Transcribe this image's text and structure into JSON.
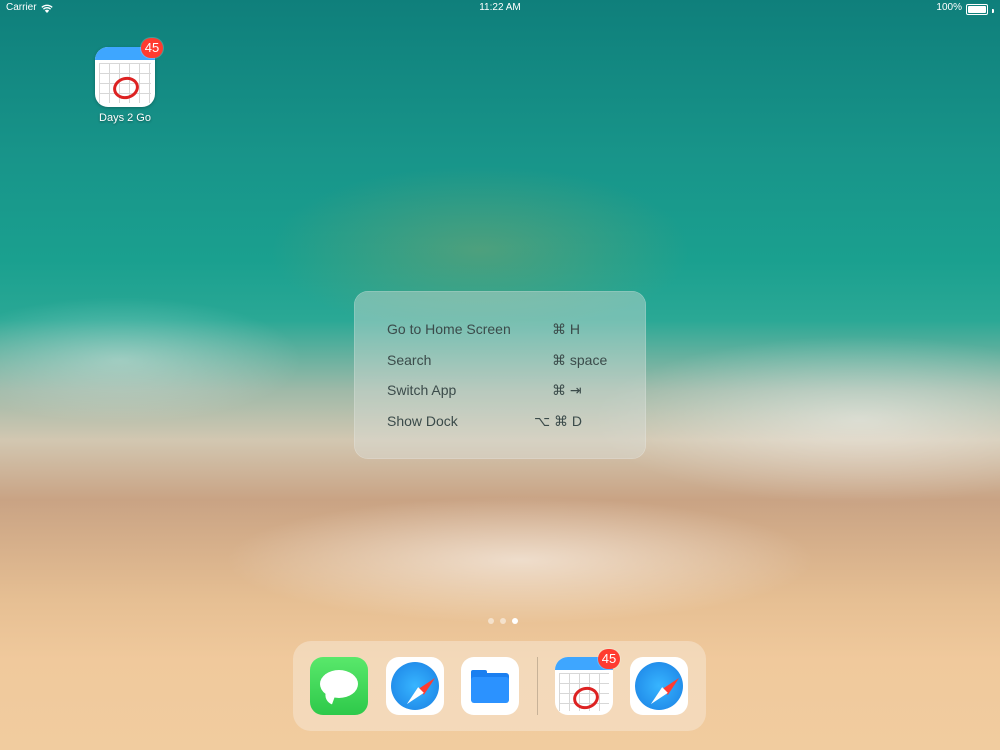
{
  "status_bar": {
    "carrier": "Carrier",
    "time": "11:22 AM",
    "battery": "100%"
  },
  "home_apps": [
    {
      "label": "Days 2 Go",
      "badge": "45"
    }
  ],
  "shortcuts": [
    {
      "action": "Go to Home Screen",
      "keys": "⌘ H"
    },
    {
      "action": "Search",
      "keys": "⌘ space"
    },
    {
      "action": "Switch App",
      "keys": "⌘ ⇥"
    },
    {
      "action": "Show Dock",
      "keys": "⌥ ⌘ D"
    }
  ],
  "page_indicator": {
    "pages": 3,
    "current": 3
  },
  "dock": {
    "apps": [
      {
        "name": "Messages",
        "icon": "messages-icon"
      },
      {
        "name": "Safari",
        "icon": "safari-icon"
      },
      {
        "name": "Files",
        "icon": "files-icon"
      }
    ],
    "recent_apps": [
      {
        "name": "Days 2 Go",
        "icon": "calendar-icon",
        "badge": "45"
      },
      {
        "name": "Safari",
        "icon": "safari-icon"
      }
    ]
  },
  "colors": {
    "badge": "#ff3b30",
    "shortcut_text": "#3b4b4a"
  }
}
